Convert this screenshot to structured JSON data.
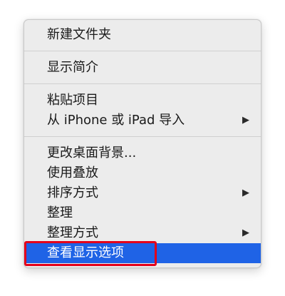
{
  "menu": {
    "items": [
      {
        "label": "新建文件夹"
      },
      {
        "label": "显示简介"
      },
      {
        "label": "粘贴项目"
      },
      {
        "label": "从 iPhone 或 iPad 导入",
        "submenu_arrow": "▶"
      },
      {
        "label": "更改桌面背景..."
      },
      {
        "label": "使用叠放"
      },
      {
        "label": "排序方式",
        "submenu_arrow": "▶"
      },
      {
        "label": "整理"
      },
      {
        "label": "整理方式",
        "submenu_arrow": "▶"
      },
      {
        "label": "查看显示选项",
        "highlighted": true
      }
    ]
  },
  "colors": {
    "highlight": "#1f63e6",
    "annotation": "#e3001b",
    "menu_background": "#ececec"
  }
}
